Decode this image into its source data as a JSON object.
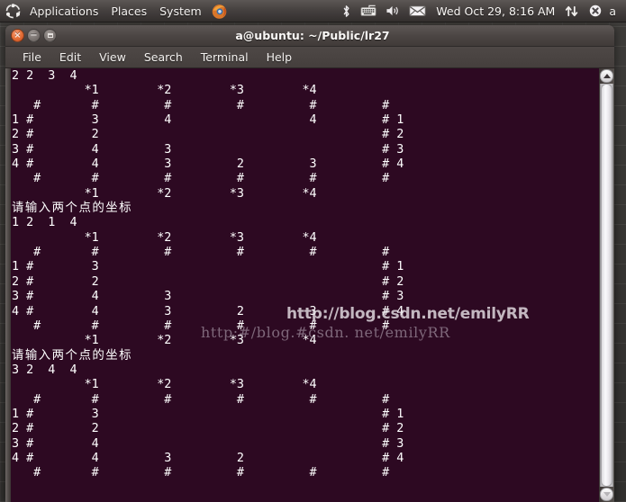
{
  "panel": {
    "logo_icon": "ubuntu-logo-icon",
    "menus": [
      "Applications",
      "Places",
      "System"
    ],
    "firefox_icon": "firefox-icon",
    "tray": {
      "bluetooth_icon": "bluetooth-icon",
      "keyboard_icon": "keyboard-icon",
      "volume_icon": "volume-icon",
      "mail_icon": "mail-envelope-icon",
      "clock": "Wed Oct 29,  8:16 AM",
      "network_icon": "network-updown-icon",
      "error_icon": "error-circle-icon",
      "user_letter": "a"
    }
  },
  "window": {
    "title": "a@ubuntu: ~/Public/lr27",
    "buttons": {
      "close": "×",
      "minimize": "−",
      "maximize": "maximize"
    },
    "menubar": [
      "File",
      "Edit",
      "View",
      "Search",
      "Terminal",
      "Help"
    ]
  },
  "terminal": {
    "colors": {
      "background": "#2d0922",
      "foreground": "#ffffff"
    },
    "lines": [
      "2 2  3  4",
      "          *1        *2        *3        *4",
      "   #       #         #         #         #         #",
      "1 #        3         4                   4         # 1",
      "2 #        2                                       # 2",
      "3 #        4         3                             # 3",
      "4 #        4         3         2         3         # 4",
      "   #       #         #         #         #         #",
      "          *1        *2        *3        *4",
      "请输入两个点的坐标",
      "1 2  1  4",
      "          *1        *2        *3        *4",
      "   #       #         #         #         #         #",
      "1 #        3                                       # 1",
      "2 #        2                                       # 2",
      "3 #        4         3                             # 3",
      "4 #        4         3         2         3         # 4",
      "   #       #         #         #         #         #",
      "          *1        *2        *3        *4",
      "请输入两个点的坐标",
      "3 2  4  4",
      "          *1        *2        *3        *4",
      "   #       #         #         #         #         #",
      "1 #        3                                       # 1",
      "2 #        2                                       # 2",
      "3 #        4                                       # 3",
      "4 #        4         3         2                   # 4",
      "   #       #         #         #         #         #"
    ],
    "prompt_text": "请输入两个点的坐标"
  },
  "watermarks": {
    "bold": "http://blog.csdn.net/emilyRR",
    "serif": "http:#/blog.#csdn. net/emilyRR"
  },
  "scrollbar": {
    "up_arrow_icon": "scroll-up-arrow-icon",
    "down_arrow_icon": "scroll-down-arrow-icon",
    "thumb": "scrollbar-thumb"
  }
}
